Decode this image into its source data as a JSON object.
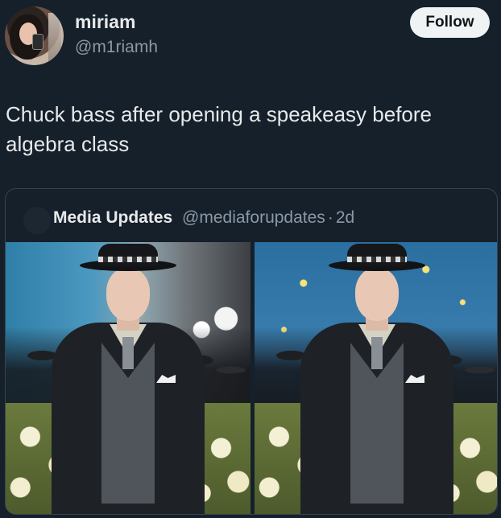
{
  "author": {
    "display_name": "miriam",
    "handle": "@m1riamh",
    "avatar_icon": "profile-photo-avatar"
  },
  "follow_button": {
    "label": "Follow"
  },
  "tweet": {
    "text": "Chuck bass after opening a speakeasy before algebra class"
  },
  "quoted_tweet": {
    "display_name": "Media Updates",
    "handle": "@mediaforupdates",
    "separator": "·",
    "age": "2d",
    "images": [
      {
        "description_icon": "photo-man-in-fedora-left"
      },
      {
        "description_icon": "photo-man-in-fedora-right"
      }
    ]
  },
  "colors": {
    "background": "#15202b",
    "text_primary": "#e7e9ea",
    "text_secondary": "#8b98a5",
    "button_bg": "#eff3f4",
    "border": "#38444d"
  }
}
